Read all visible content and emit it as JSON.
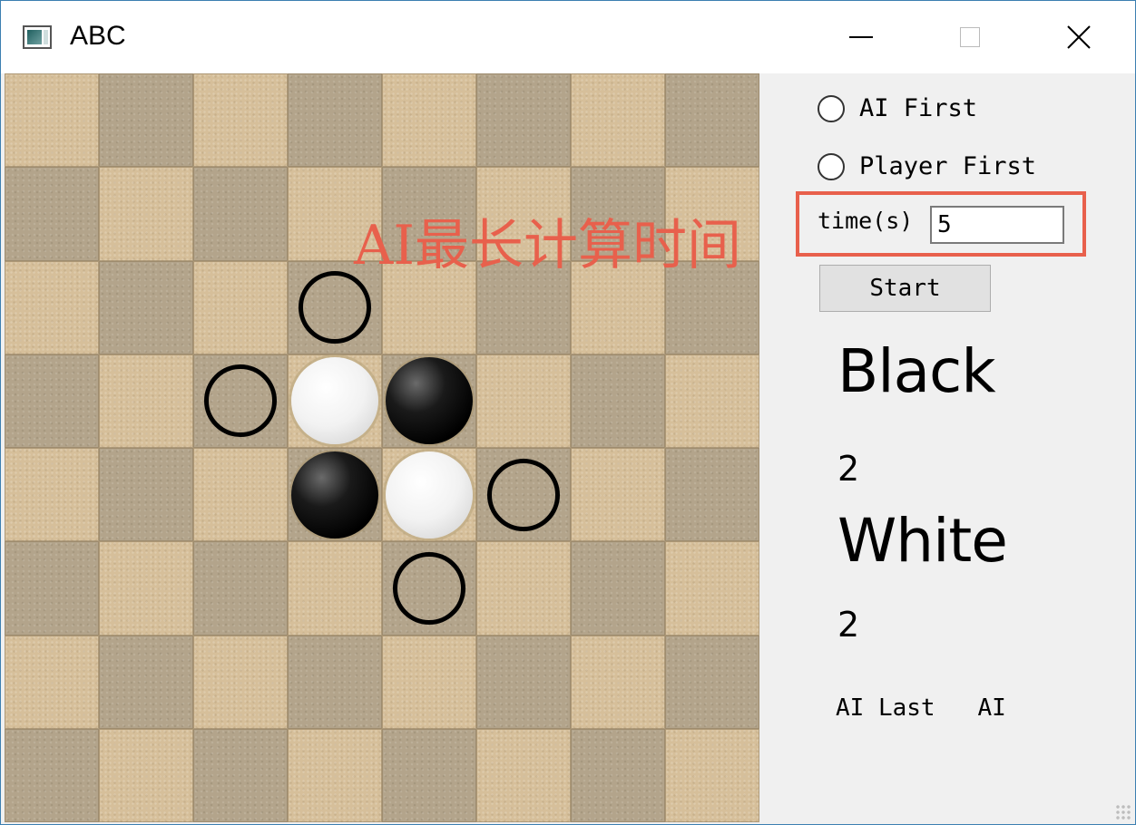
{
  "window": {
    "title": "ABC",
    "app_icon": "window-app-icon",
    "controls": {
      "minimize_icon": "minimize-icon",
      "maximize_icon": "maximize-icon",
      "close_symbol": "✕"
    }
  },
  "board": {
    "size": 8,
    "pieces": [
      {
        "row": 3,
        "col": 3,
        "color": "white"
      },
      {
        "row": 3,
        "col": 4,
        "color": "black"
      },
      {
        "row": 4,
        "col": 3,
        "color": "black"
      },
      {
        "row": 4,
        "col": 4,
        "color": "white"
      }
    ],
    "hints": [
      {
        "row": 2,
        "col": 3
      },
      {
        "row": 3,
        "col": 2
      },
      {
        "row": 4,
        "col": 5
      },
      {
        "row": 5,
        "col": 4
      }
    ],
    "colors": {
      "light": "#d6bf9a",
      "dark": "#b3a48b"
    }
  },
  "annotation": {
    "text": "AI最长计算时间",
    "color": "#e8604c"
  },
  "controls": {
    "ai_first_label": "AI First",
    "player_first_label": "Player First",
    "time_label": "time(s)",
    "time_value": "5",
    "start_label": "Start"
  },
  "score": {
    "black_label": "Black",
    "black_count": "2",
    "white_label": "White",
    "white_count": "2"
  },
  "status": {
    "text": "AI Last   AI"
  }
}
